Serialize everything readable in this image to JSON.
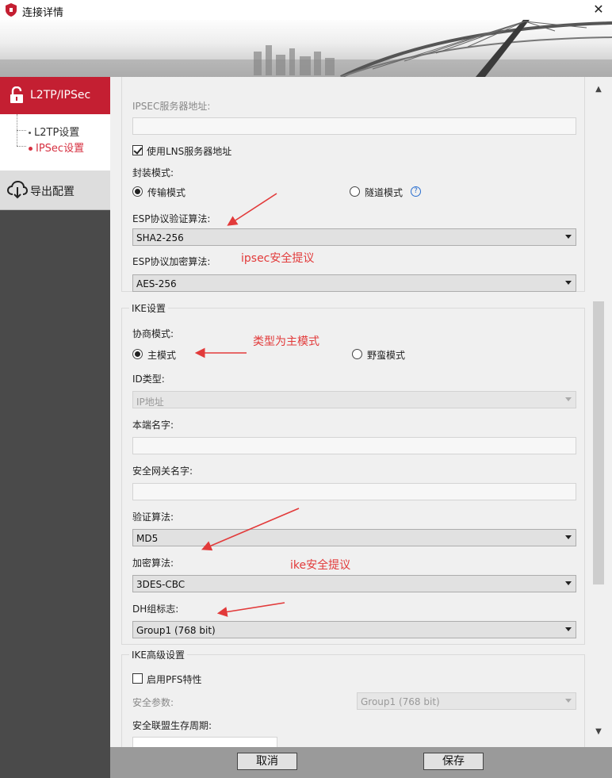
{
  "window": {
    "title": "连接详情",
    "close_glyph": "✕"
  },
  "sidebar": {
    "l2tp_ipsec": "L2TP/IPSec",
    "l2tp_settings": "L2TP设置",
    "ipsec_settings": "IPSec设置",
    "export": "导出配置"
  },
  "ipsec": {
    "server_addr_label": "IPSEC服务器地址:",
    "server_addr_value": "",
    "use_lns_label": "使用LNS服务器地址",
    "encap_label": "封装模式:",
    "transport": "传输模式",
    "tunnel": "隧道模式",
    "help_glyph": "?",
    "esp_auth_label": "ESP协议验证算法:",
    "esp_auth_value": "SHA2-256",
    "esp_enc_label": "ESP协议加密算法:",
    "esp_enc_value": "AES-256"
  },
  "ike": {
    "group_title": "IKE设置",
    "negotiation_label": "协商模式:",
    "main_mode": "主模式",
    "aggressive_mode": "野蛮模式",
    "id_type_label": "ID类型:",
    "id_type_value": "IP地址",
    "local_name_label": "本端名字:",
    "gateway_name_label": "安全网关名字:",
    "auth_label": "验证算法:",
    "auth_value": "MD5",
    "enc_label": "加密算法:",
    "enc_value": "3DES-CBC",
    "dh_label": "DH组标志:",
    "dh_value": "Group1 (768 bit)"
  },
  "ike_advanced": {
    "group_title": "IKE高级设置",
    "pfs_label": "启用PFS特性",
    "security_param_label": "安全参数:",
    "security_param_value": "Group1 (768 bit)",
    "lifetime_label": "安全联盟生存周期:"
  },
  "annotations": {
    "ipsec_note": "ipsec安全提议",
    "main_mode_note": "类型为主模式",
    "ike_note": "ike安全提议"
  },
  "footer": {
    "cancel": "取消",
    "save": "保存"
  },
  "colors": {
    "accent": "#c41f32",
    "sidebar": "#4a4a4a",
    "annotation": "#e23a3a"
  }
}
